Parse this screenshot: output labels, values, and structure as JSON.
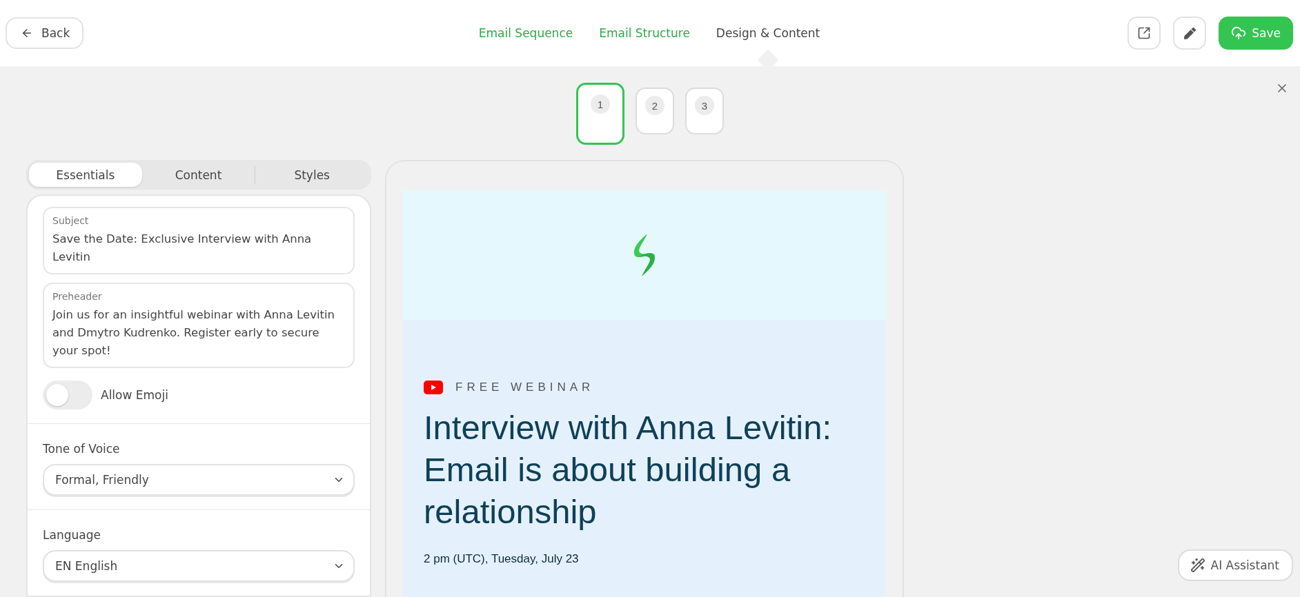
{
  "header": {
    "back": "Back",
    "nav": [
      {
        "label": "Email Sequence",
        "selected": false
      },
      {
        "label": "Email Structure",
        "selected": false
      },
      {
        "label": "Design & Content",
        "selected": true
      }
    ],
    "save": "Save"
  },
  "steps": [
    {
      "number": "1",
      "selected": true
    },
    {
      "number": "2",
      "selected": false
    },
    {
      "number": "3",
      "selected": false
    }
  ],
  "panel": {
    "tabs": [
      {
        "label": "Essentials",
        "selected": true
      },
      {
        "label": "Content",
        "selected": false
      },
      {
        "label": "Styles",
        "selected": false
      }
    ],
    "subject": {
      "label": "Subject",
      "value": "Save the Date: Exclusive Interview with Anna Levitin"
    },
    "preheader": {
      "label": "Preheader",
      "value": "Join us for an insightful webinar with Anna Levitin and Dmytro Kudrenko. Register early to secure your spot!"
    },
    "emoji": {
      "label": "Allow Emoji",
      "on": false
    },
    "tone": {
      "label": "Tone of Voice",
      "value": "Formal, Friendly"
    },
    "language": {
      "label": "Language",
      "value": "EN English"
    }
  },
  "preview": {
    "eyebrow": "FREE WEBINAR",
    "title": "Interview with Anna Levitin: Email is about building a relationship",
    "date": "2 pm (UTC), Tuesday, July 23"
  },
  "ai_button": "AI Assistant"
}
